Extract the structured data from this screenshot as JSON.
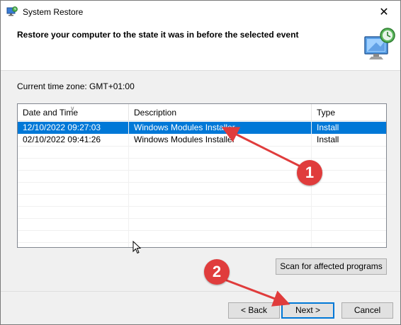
{
  "window": {
    "title": "System Restore",
    "close_glyph": "✕"
  },
  "header": {
    "title": "Restore your computer to the state it was in before the selected event",
    "graphic_icon": "system-restore-monitor-icon"
  },
  "timezone": {
    "label": "Current time zone: GMT+01:00"
  },
  "table": {
    "columns": [
      "Date and Time",
      "Description",
      "Type"
    ],
    "sort_indicator": "∨",
    "rows": [
      {
        "date": "12/10/2022 09:27:03",
        "description": "Windows Modules Installer",
        "type": "Install",
        "selected": true
      },
      {
        "date": "02/10/2022 09:41:26",
        "description": "Windows Modules Installer",
        "type": "Install",
        "selected": false
      }
    ]
  },
  "buttons": {
    "scan": "Scan for affected programs",
    "back": "< Back",
    "next": "Next >",
    "cancel": "Cancel"
  },
  "annotations": {
    "marker_1": "1",
    "marker_2": "2",
    "color": "#e03c3c"
  },
  "colors": {
    "selection": "#0078d7",
    "default_button_border": "#0078d7"
  }
}
